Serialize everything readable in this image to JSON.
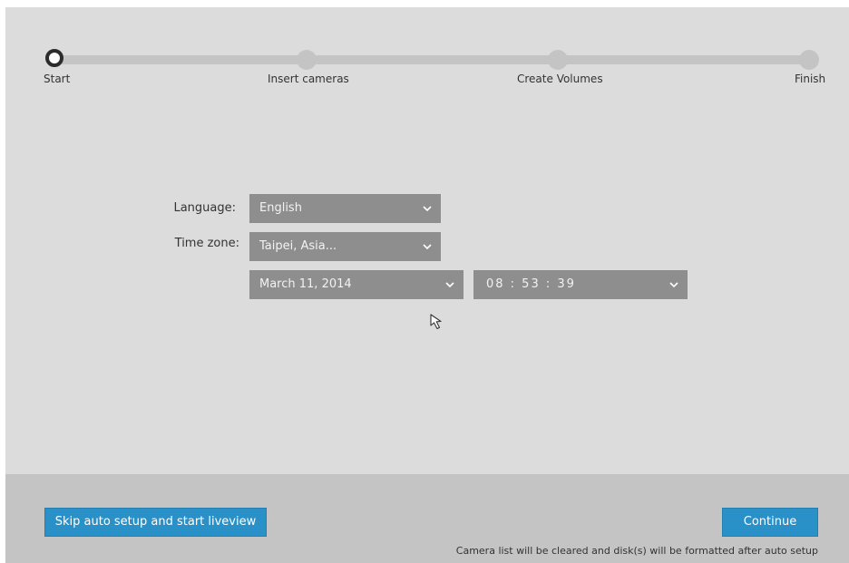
{
  "stepper": {
    "steps": [
      {
        "label": "Start",
        "current": true
      },
      {
        "label": "Insert cameras",
        "current": false
      },
      {
        "label": "Create Volumes",
        "current": false
      },
      {
        "label": "Finish",
        "current": false
      }
    ]
  },
  "form": {
    "language_label": "Language:",
    "language_value": "English",
    "timezone_label": "Time zone:",
    "timezone_value": "Taipei, Asia...",
    "date_value": "March 11, 2014",
    "time_value": "08 : 53 : 39"
  },
  "footer": {
    "skip_button": "Skip auto setup and start liveview",
    "continue_button": "Continue",
    "warning_note": "Camera list will be cleared and disk(s) will be formatted after auto setup"
  },
  "colors": {
    "background": "#dcdcdc",
    "footer": "#c4c4c4",
    "select": "#8e8e8e",
    "accent": "#2a90c8"
  }
}
